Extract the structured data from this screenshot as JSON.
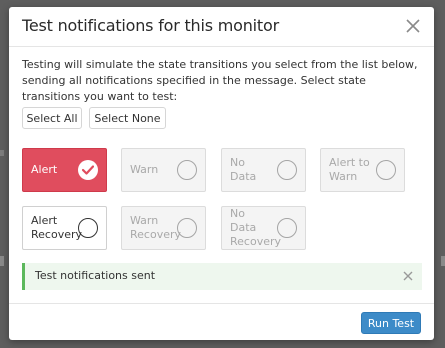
{
  "dialog": {
    "title": "Test notifications for this monitor",
    "description": "Testing will simulate the state transitions you select from the list below, sending all notifications specified in the message. Select state transitions you want to test:"
  },
  "selection": {
    "select_all_label": "Select All",
    "select_none_label": "Select None"
  },
  "transitions": [
    {
      "label": "Alert",
      "state": "selected"
    },
    {
      "label": "Warn",
      "state": "disabled"
    },
    {
      "label": "No Data",
      "state": "disabled"
    },
    {
      "label": "Alert to Warn",
      "state": "disabled"
    },
    {
      "label": "Alert Recovery",
      "state": "enabled"
    },
    {
      "label": "Warn Recovery",
      "state": "disabled"
    },
    {
      "label": "No Data Recovery",
      "state": "disabled"
    }
  ],
  "status_banner": {
    "text": "Test notifications sent"
  },
  "footer": {
    "run_test_label": "Run Test"
  },
  "colors": {
    "selected_tile": "#e04d5e",
    "success_border": "#5cb85c",
    "primary_button": "#3d8bc8"
  }
}
